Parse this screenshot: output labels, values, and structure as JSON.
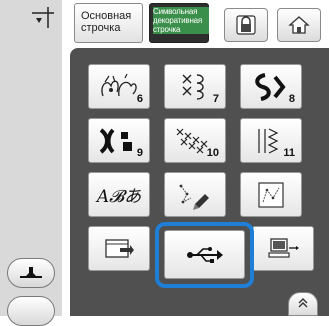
{
  "tabs": {
    "basic_label": "Основная строчка",
    "decorative_label": "Символьная декоративная строчка"
  },
  "stitch_grid": {
    "numbers": [
      "6",
      "7",
      "8",
      "9",
      "10",
      "11"
    ],
    "font_button_text": "A𝓑あ"
  },
  "icons": {
    "needle_position": "needle-position-icon",
    "lock": "lock-icon",
    "home": "home-icon",
    "usb": "usb-icon",
    "pocket": "memory-pocket-icon",
    "computer": "computer-icon",
    "scroll_up": "double-chevron-up-icon",
    "foot": "presser-foot-icon"
  },
  "colors": {
    "panel": "#505050",
    "highlight": "#1f7fd6",
    "deco_tab_green": "#3a8f4a"
  }
}
